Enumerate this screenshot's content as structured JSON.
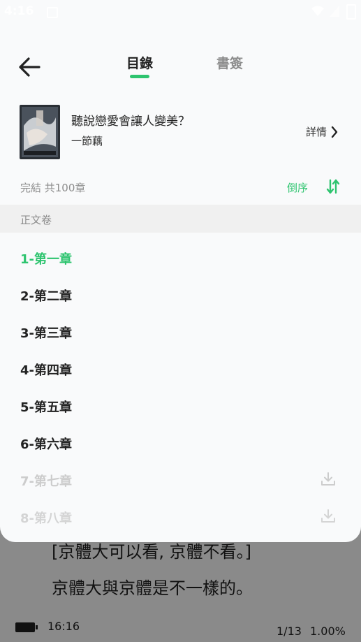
{
  "status_bar": {
    "time": "4:16"
  },
  "header": {
    "back_icon": "back-arrow-icon",
    "tabs": [
      {
        "label": "目錄",
        "active": true
      },
      {
        "label": "書簽",
        "active": false
      }
    ]
  },
  "book": {
    "title": "聽說戀愛會讓人變美？",
    "author": "一節藕",
    "details_label": "詳情"
  },
  "toc_info": {
    "status": "完結  共100章",
    "sort_label": "倒序",
    "sort_icon": "sort-arrows-icon"
  },
  "volume": {
    "title": "正文卷"
  },
  "chapters": [
    {
      "label": "1-第一章",
      "state": "current"
    },
    {
      "label": "2-第二章",
      "state": "normal"
    },
    {
      "label": "3-第三章",
      "state": "normal"
    },
    {
      "label": "4-第四章",
      "state": "normal"
    },
    {
      "label": "5-第五章",
      "state": "normal"
    },
    {
      "label": "6-第六章",
      "state": "normal"
    },
    {
      "label": "7-第七章",
      "state": "locked",
      "icon": "download-icon"
    },
    {
      "label": "8-第八章",
      "state": "locked",
      "icon": "download-icon"
    }
  ],
  "reader": {
    "lines": [
      "[京體大可以看, 京體不看。]",
      "京體大與京體是不一樣的。"
    ],
    "footer_time": "16:16",
    "page": "1/13",
    "progress": "1.00%"
  },
  "colors": {
    "accent": "#2ec46f",
    "text": "#222222",
    "muted": "#8d8d8d",
    "disabled": "#c8c8c8"
  }
}
